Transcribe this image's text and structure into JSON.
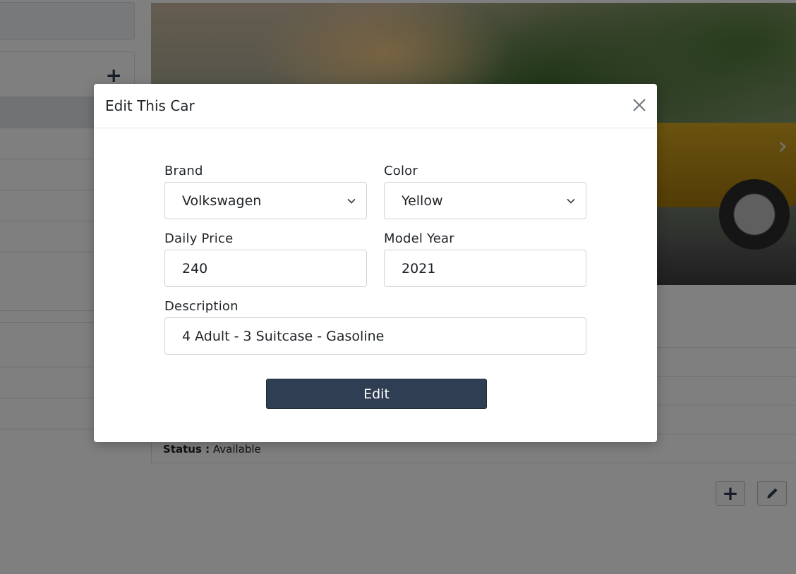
{
  "background": {
    "status_label": "Status :",
    "status_value": "Available",
    "carousel_next_glyph": "›",
    "add_glyph": "+"
  },
  "modal": {
    "title": "Edit This Car",
    "fields": {
      "brand": {
        "label": "Brand",
        "value": "Volkswagen"
      },
      "color": {
        "label": "Color",
        "value": "Yellow"
      },
      "daily_price": {
        "label": "Daily Price",
        "value": "240"
      },
      "model_year": {
        "label": "Model Year",
        "value": "2021"
      },
      "description": {
        "label": "Description",
        "value": "4 Adult - 3 Suitcase - Gasoline"
      }
    },
    "submit_label": "Edit"
  },
  "colors": {
    "accent": "#2f3e53",
    "backdrop": "rgba(0,0,0,0.5)"
  },
  "icons": [
    "plus-icon",
    "pencil-icon",
    "chevron-right-icon",
    "close-icon",
    "chevron-down-icon"
  ]
}
